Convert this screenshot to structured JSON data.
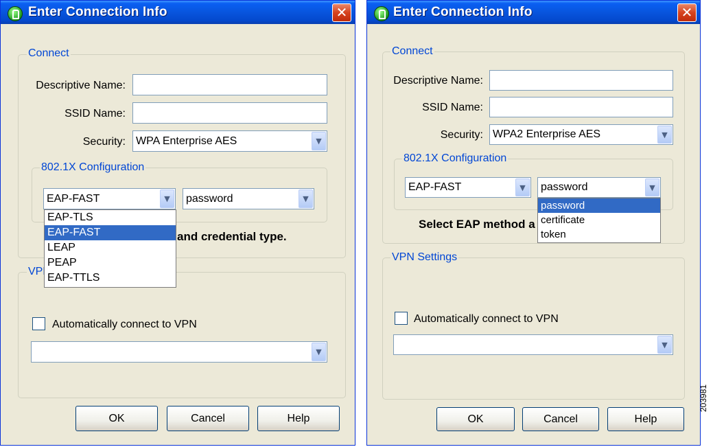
{
  "figure_id": "203981",
  "left_dialog": {
    "title": "Enter Connection Info",
    "close_glyph": "✕",
    "connect_group": "Connect",
    "descriptive_name_label": "Descriptive Name:",
    "descriptive_name_value": "",
    "ssid_label": "SSID Name:",
    "ssid_value": "",
    "security_label": "Security:",
    "security_value": "WPA Enterprise AES",
    "config_group": "802.1X Configuration",
    "eap_value": "EAP-FAST",
    "credential_value": "password",
    "eap_options": [
      "EAP-TLS",
      "EAP-FAST",
      "LEAP",
      "PEAP",
      "EAP-TTLS"
    ],
    "eap_selected_index": 1,
    "instruction_visible": "and credential type.",
    "vpn_group_visible": "VPN",
    "auto_vpn_label": "Automatically connect to VPN",
    "auto_vpn_checked": false,
    "vpn_value": "",
    "ok_label": "OK",
    "cancel_label": "Cancel",
    "help_label": "Help"
  },
  "right_dialog": {
    "title": "Enter Connection Info",
    "close_glyph": "✕",
    "connect_group": "Connect",
    "descriptive_name_label": "Descriptive Name:",
    "descriptive_name_value": "",
    "ssid_label": "SSID Name:",
    "ssid_value": "",
    "security_label": "Security:",
    "security_value": "WPA2 Enterprise AES",
    "config_group": "802.1X Configuration",
    "eap_value": "EAP-FAST",
    "credential_value": "password",
    "credential_options": [
      "password",
      "certificate",
      "token"
    ],
    "credential_selected_index": 0,
    "instruction_visible": "Select EAP method a",
    "vpn_group": "VPN Settings",
    "auto_vpn_label": "Automatically connect to VPN",
    "auto_vpn_checked": false,
    "vpn_value": "",
    "ok_label": "OK",
    "cancel_label": "Cancel",
    "help_label": "Help"
  },
  "icons": {
    "title_icon": "wireless-connection-icon",
    "dropdown": "chevron-down-icon",
    "close": "close-icon"
  },
  "colors": {
    "titlebar": "#0855dd",
    "dialog_background": "#ece9d8",
    "group_legend": "#0046d5",
    "selection": "#316ac5",
    "close_button": "#d6431f"
  }
}
